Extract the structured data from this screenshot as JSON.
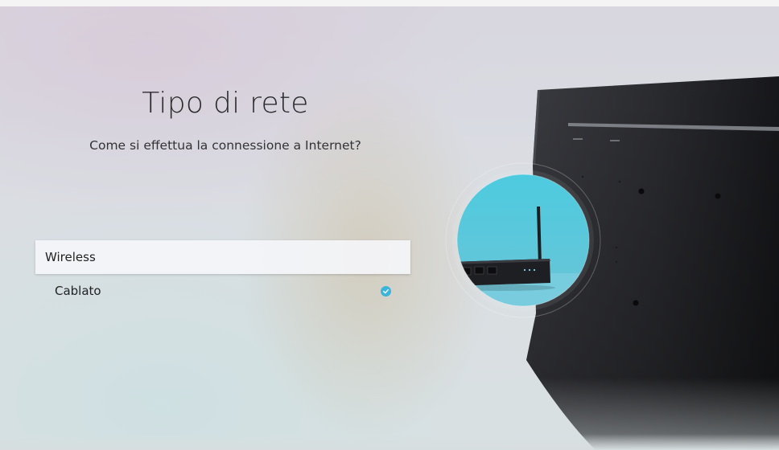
{
  "page": {
    "title": "Tipo di rete",
    "subtitle": "Come si effettua la connessione a Internet?"
  },
  "options": [
    {
      "label": "Wireless",
      "selected": true,
      "checked": false
    },
    {
      "label": "Cablato",
      "selected": false,
      "checked": true
    }
  ],
  "illustration": {
    "name": "tv-back-with-router",
    "icon": "check-circle-icon"
  },
  "colors": {
    "accent": "#3bb4dc",
    "text": "#2c2c2e",
    "tv_panel": "#2a2b2f",
    "circle": "#57c6dc"
  }
}
